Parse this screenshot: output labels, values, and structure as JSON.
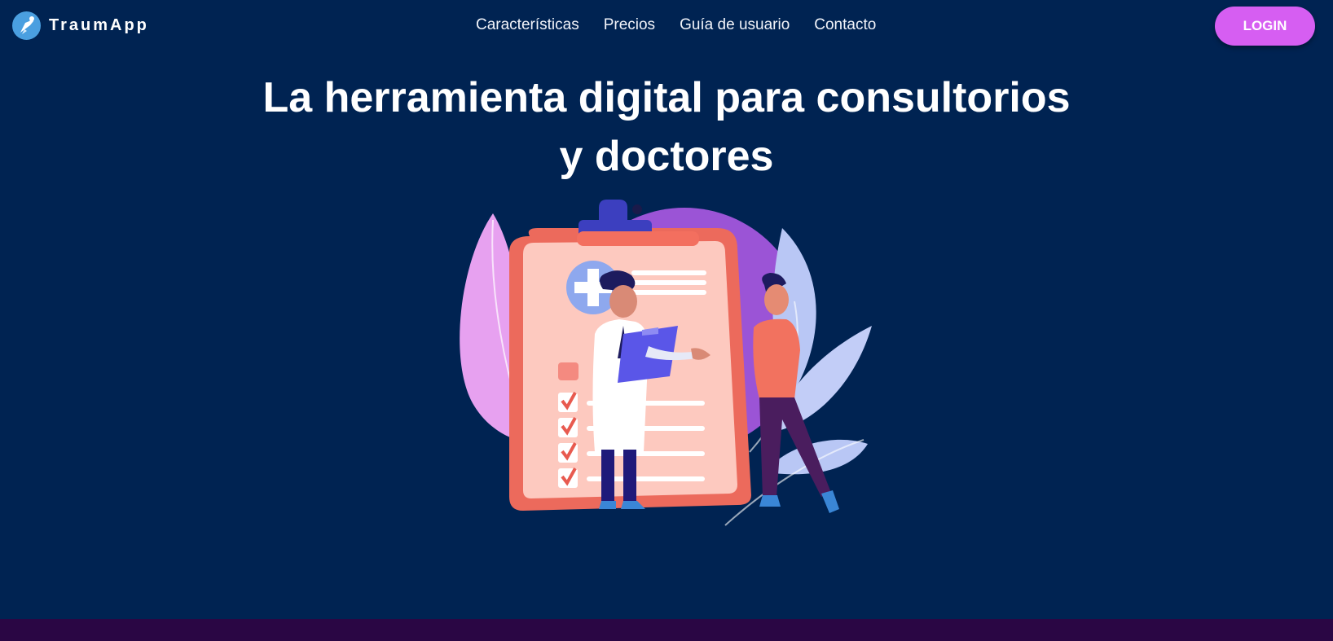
{
  "brand": {
    "name": "TraumApp",
    "logo_icon": "traumapp-logo-icon"
  },
  "nav": {
    "links": [
      {
        "label": "Características"
      },
      {
        "label": "Precios"
      },
      {
        "label": "Guía de usuario"
      },
      {
        "label": "Contacto"
      }
    ],
    "login_label": "LOGIN"
  },
  "hero": {
    "title_line1": "La herramienta digital para consultorios",
    "title_line2": "y doctores",
    "illustration": "doctor-patient-clipboard-illustration"
  },
  "colors": {
    "background": "#002352",
    "accent": "#d65ef2",
    "footer": "#2a0644"
  }
}
